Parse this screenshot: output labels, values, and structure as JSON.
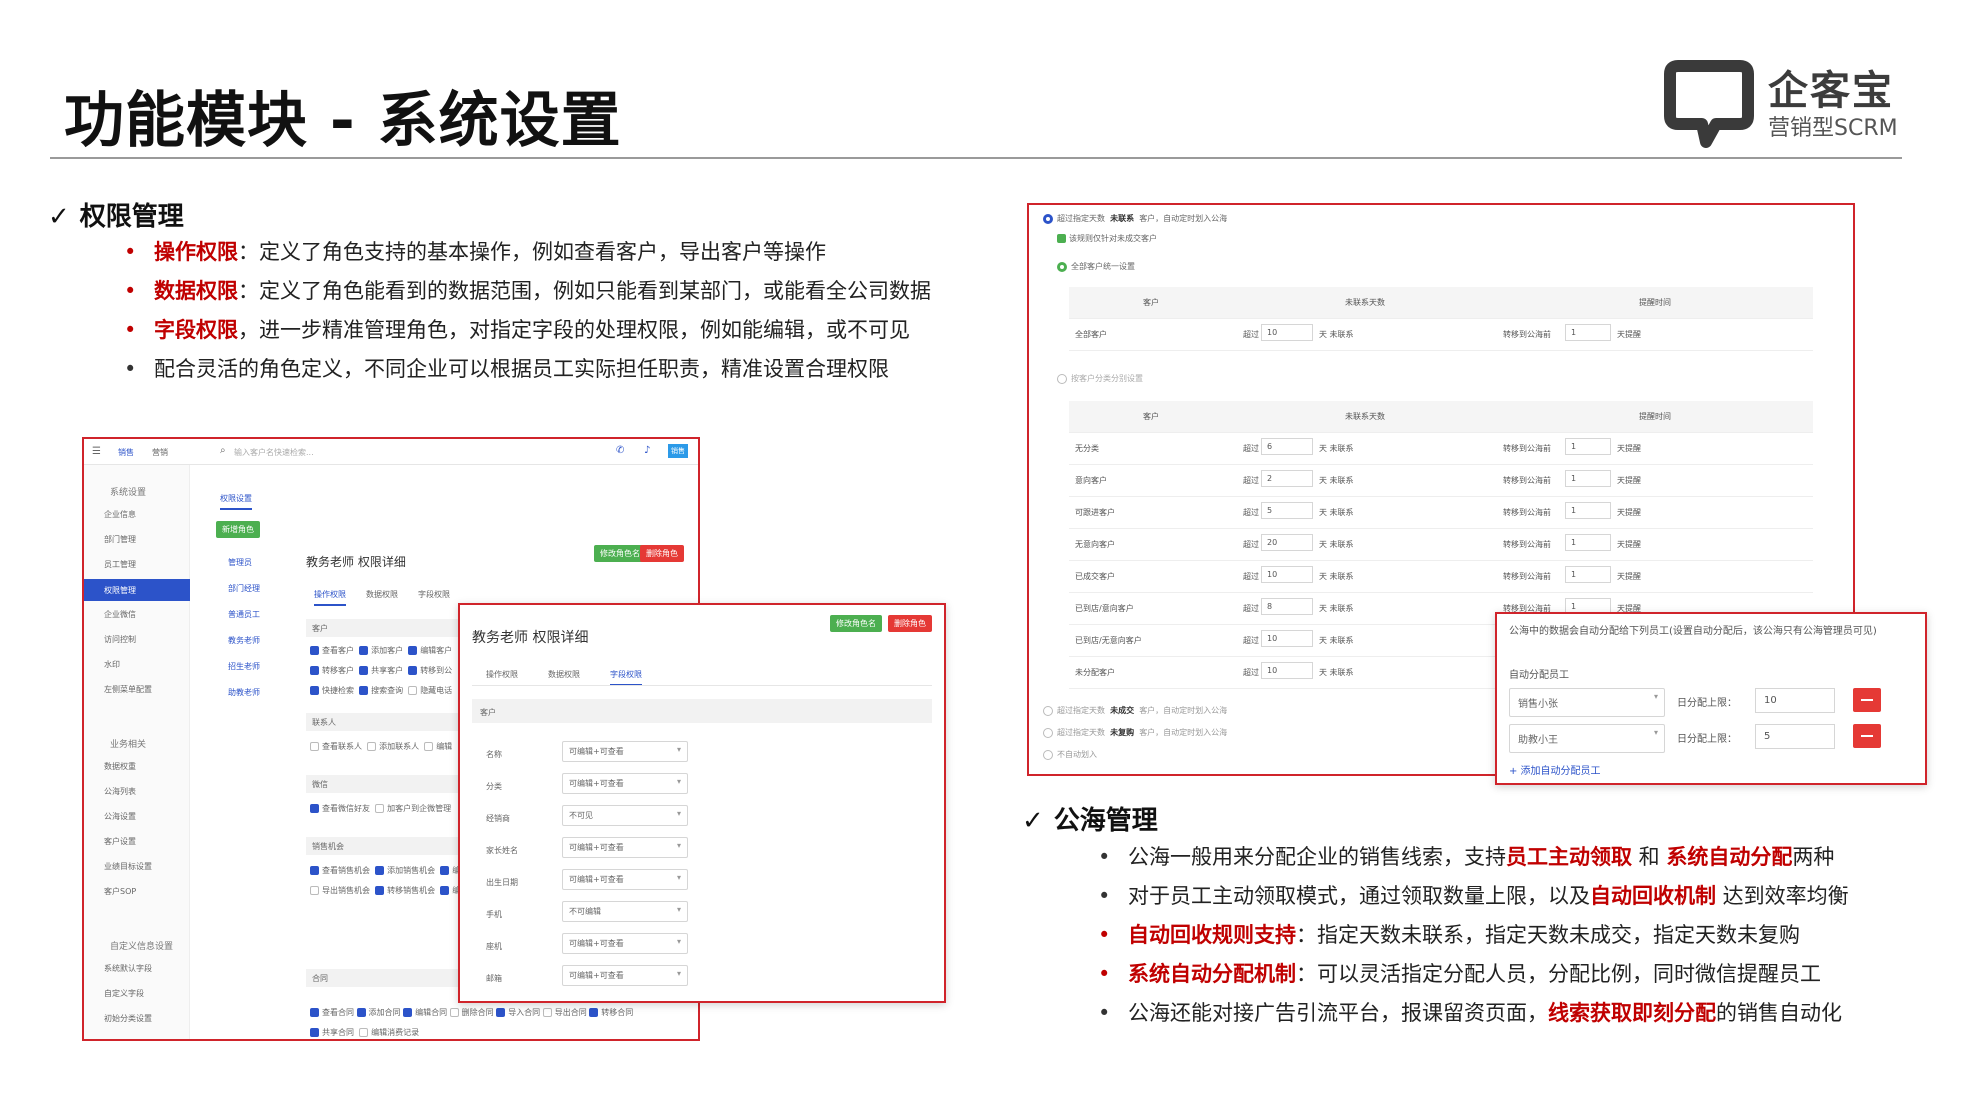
{
  "page": {
    "title": "功能模块 - 系统设置"
  },
  "logo": {
    "name": "企客宝",
    "subtitle": "营销型SCRM"
  },
  "perm_section": {
    "heading": "权限管理",
    "bullets": [
      {
        "key": "操作权限",
        "text": "：定义了角色支持的基本操作，例如查看客户，导出客户等操作"
      },
      {
        "key": "数据权限",
        "text": "：定义了角色能看到的数据范围，例如只能看到某部门，或能看全公司数据"
      },
      {
        "key": "字段权限",
        "text": "，进一步精准管理角色，对指定字段的处理权限，例如能编辑，或不可见"
      },
      {
        "key": "",
        "text": "配合灵活的角色定义，不同企业可以根据员工实际担任职责，精准设置合理权限"
      }
    ]
  },
  "sea_section": {
    "heading": "公海管理",
    "bullets": [
      {
        "p1": "公海一般用来分配企业的销售线索，支持",
        "h1": "员工主动领取",
        "p2": " 和 ",
        "h2": "系统自动分配",
        "p3": "两种"
      },
      {
        "p1": "对于员工主动领取模式，通过领取数量上限，以及",
        "h1": "自动回收机制",
        "p2": " 达到效率均衡"
      },
      {
        "h1": "自动回收规则支持",
        "p1": "：指定天数未联系，指定天数未成交，指定天数未复购"
      },
      {
        "h1": "系统自动分配机制",
        "p1": "：可以灵活指定分配人员，分配比例，同时微信提醒员工"
      },
      {
        "p1": "公海还能对接广告引流平台，报课留资页面，",
        "h1": "线索获取即刻分配",
        "p2": "的销售自动化"
      }
    ]
  },
  "shot_left": {
    "topnav": [
      "销售",
      "营销"
    ],
    "search_placeholder": "输入客户名快速检索...",
    "avatar_text": "销售",
    "sidebar_groups": [
      {
        "title": "系统设置",
        "items": [
          "企业信息",
          "部门管理",
          "员工管理",
          "权限管理",
          "企业微信",
          "访问控制",
          "水印",
          "左侧菜单配置"
        ]
      },
      {
        "title": "业务相关",
        "items": [
          "数据权重",
          "公海列表",
          "公海设置",
          "客户设置",
          "业绩目标设置",
          "客户SOP"
        ]
      },
      {
        "title": "自定义信息设置",
        "items": [
          "系统默认字段",
          "自定义字段",
          "初始分类设置"
        ]
      }
    ],
    "active_item": "权限管理",
    "tab_label": "权限设置",
    "new_role": "新增角色",
    "roles": [
      "管理员",
      "部门经理",
      "普通员工",
      "教务老师",
      "招生老师",
      "助教老师"
    ],
    "detail_title": "教务老师 权限详细",
    "btn_rename": "修改角色名",
    "btn_delete": "删除角色",
    "tabs": [
      "操作权限",
      "数据权限",
      "字段权限"
    ],
    "groups": [
      {
        "name": "客户",
        "rows": [
          [
            "查看客户",
            "添加客户",
            "编辑客户"
          ],
          [
            "转移客户",
            "共享客户",
            "转移到公"
          ],
          [
            "快捷检索",
            "搜索查询",
            "隐藏电话"
          ]
        ]
      },
      {
        "name": "联系人",
        "rows": [
          [
            "查看联系人",
            "添加联系人",
            "编辑"
          ]
        ]
      },
      {
        "name": "微信",
        "rows": [
          [
            "查看微信好友",
            "加客户到企微管理"
          ]
        ]
      },
      {
        "name": "销售机会",
        "rows": [
          [
            "查看销售机会",
            "添加销售机会",
            "编"
          ],
          [
            "导出销售机会",
            "转移销售机会",
            "编"
          ]
        ]
      },
      {
        "name": "合同",
        "rows": [
          [
            "查看合同",
            "添加合同",
            "编辑合同",
            "删除合同",
            "导入合同",
            "导出合同",
            "转移合同"
          ],
          [
            "共享合同",
            "编辑消费记录"
          ]
        ]
      }
    ]
  },
  "shot_popup": {
    "title": "教务老师 权限详细",
    "btn_rename": "修改角色名",
    "btn_delete": "删除角色",
    "tabs": [
      "操作权限",
      "数据权限",
      "字段权限"
    ],
    "group": "客户",
    "fields": [
      {
        "label": "名称",
        "value": "可编辑+可查看"
      },
      {
        "label": "分类",
        "value": "可编辑+可查看"
      },
      {
        "label": "经销商",
        "value": "不可见"
      },
      {
        "label": "家长姓名",
        "value": "可编辑+可查看"
      },
      {
        "label": "出生日期",
        "value": "可编辑+可查看"
      },
      {
        "label": "手机",
        "value": "不可编辑"
      },
      {
        "label": "座机",
        "value": "可编辑+可查看"
      },
      {
        "label": "邮箱",
        "value": "可编辑+可查看"
      }
    ]
  },
  "shot_right": {
    "rule1_pre": "超过指定天数",
    "rule1_bold": "未联系",
    "rule1_post": "客户，自动定时划入公海",
    "rule_check": "该规则仅针对未成交客户",
    "radio_all": "全部客户统一设置",
    "radio_split": "按客户分类分别设置",
    "headers": [
      "客户",
      "未联系天数",
      "提醒时间"
    ],
    "prefix_over": "超过",
    "suffix_days": "天 未联系",
    "prefix_transfer": "转移到公海前",
    "suffix_remind": "天提醒",
    "all_row": {
      "name": "全部客户",
      "days": "10",
      "remind": "1"
    },
    "rows": [
      {
        "name": "无分类",
        "days": "6",
        "remind": "1"
      },
      {
        "name": "意向客户",
        "days": "2",
        "remind": "1"
      },
      {
        "name": "可跟进客户",
        "days": "5",
        "remind": "1"
      },
      {
        "name": "无意向客户",
        "days": "20",
        "remind": "1"
      },
      {
        "name": "已成交客户",
        "days": "10",
        "remind": "1"
      },
      {
        "name": "已到店/意向客户",
        "days": "8",
        "remind": "1"
      },
      {
        "name": "已到店/无意向客户",
        "days": "10",
        "remind": "1"
      },
      {
        "name": "未分配客户",
        "days": "10",
        "remind": "1"
      }
    ],
    "rule2_pre": "超过指定天数",
    "rule2_bold": "未成交",
    "rule2_post": "客户，自动定时划入公海",
    "rule3_pre": "超过指定天数",
    "rule3_bold": "未复购",
    "rule3_post": "客户，自动定时划入公海",
    "rule4": "不自动划入"
  },
  "shot_assign": {
    "note": "公海中的数据会自动分配给下列员工(设置自动分配后，该公海只有公海管理员可见)",
    "label": "自动分配员工",
    "rows": [
      {
        "name": "销售小张",
        "limit_label": "日分配上限：",
        "limit": "10"
      },
      {
        "name": "助教小王",
        "limit_label": "日分配上限：",
        "limit": "5"
      }
    ],
    "add": "+ 添加自动分配员工"
  },
  "colors": {
    "accent_red": "#c00000",
    "frame_red": "#d0242b",
    "ui_blue": "#2c53c9"
  }
}
